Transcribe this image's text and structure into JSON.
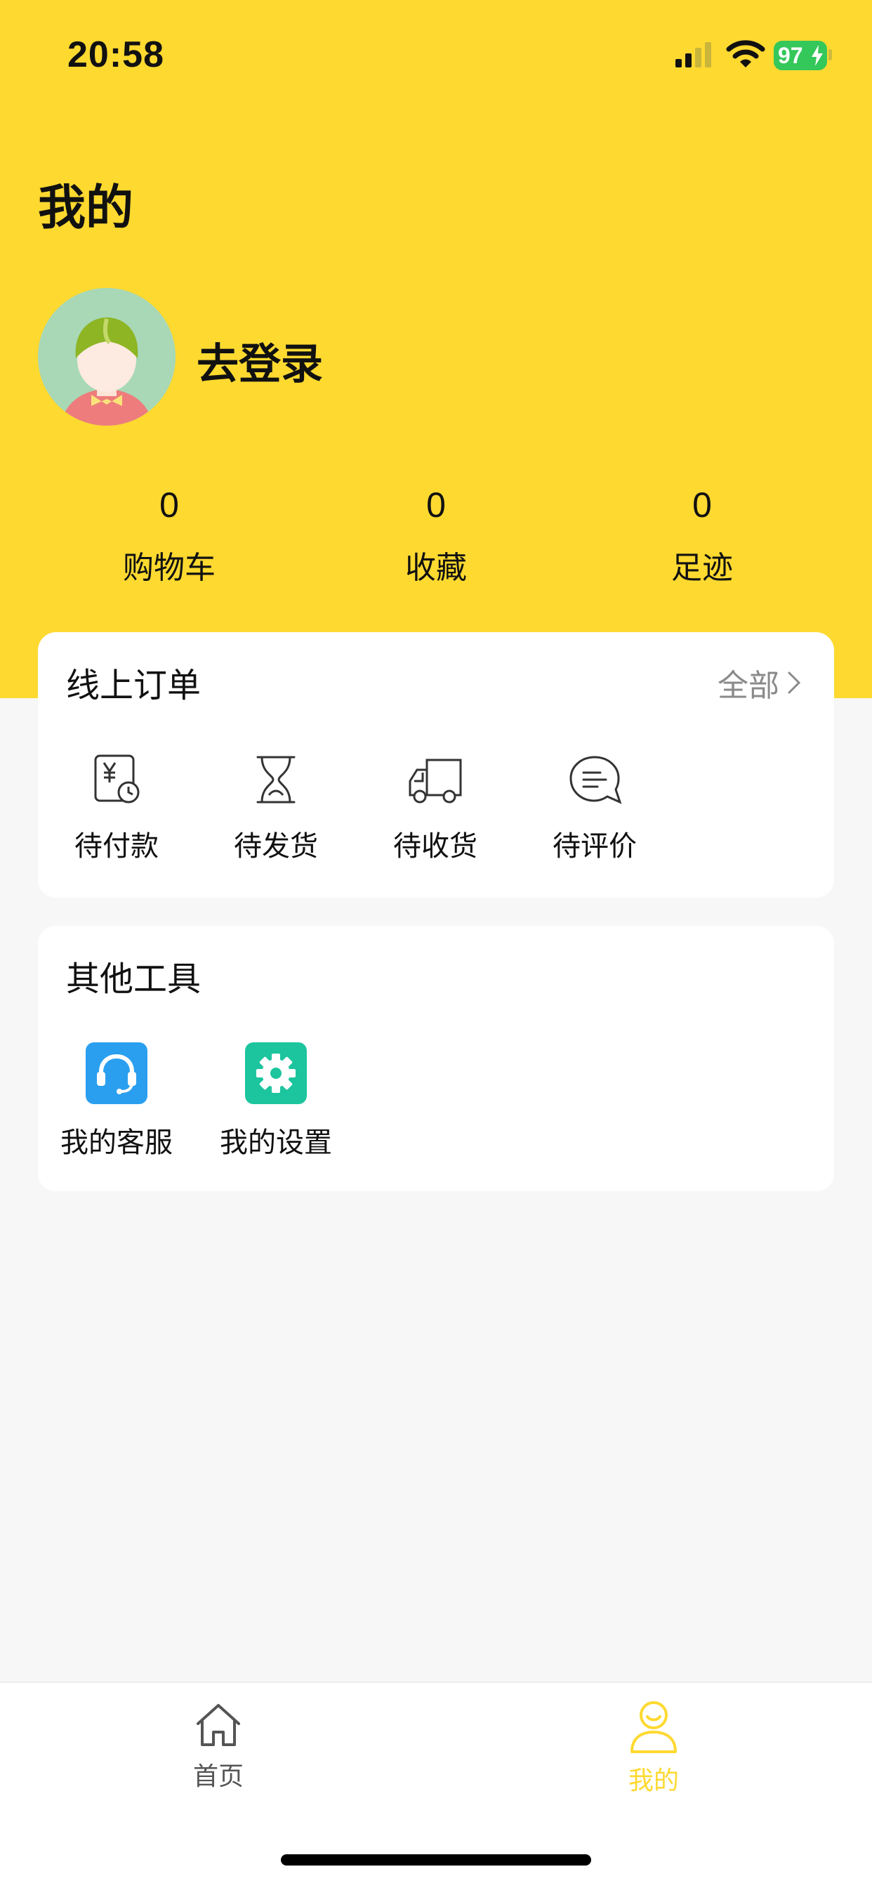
{
  "status_bar": {
    "time": "20:58",
    "battery": "97"
  },
  "header": {
    "title": "我的",
    "login_label": "去登录"
  },
  "stats": [
    {
      "value": "0",
      "label": "购物车"
    },
    {
      "value": "0",
      "label": "收藏"
    },
    {
      "value": "0",
      "label": "足迹"
    }
  ],
  "orders": {
    "title": "线上订单",
    "all_label": "全部",
    "items": [
      {
        "label": "待付款",
        "icon": "payment-pending-icon"
      },
      {
        "label": "待发货",
        "icon": "hourglass-icon"
      },
      {
        "label": "待收货",
        "icon": "truck-icon"
      },
      {
        "label": "待评价",
        "icon": "comment-icon"
      }
    ]
  },
  "tools": {
    "title": "其他工具",
    "items": [
      {
        "label": "我的客服",
        "icon": "headset-icon",
        "color": "#2a9ff0"
      },
      {
        "label": "我的设置",
        "icon": "gear-icon",
        "color": "#1cc59e"
      }
    ]
  },
  "tabbar": {
    "items": [
      {
        "label": "首页",
        "icon": "home-icon",
        "active": false
      },
      {
        "label": "我的",
        "icon": "profile-icon",
        "active": true
      }
    ],
    "active_color": "#fed930",
    "inactive_color": "#555555"
  },
  "colors": {
    "brand_yellow": "#fed930",
    "page_bg": "#f7f7f7"
  }
}
